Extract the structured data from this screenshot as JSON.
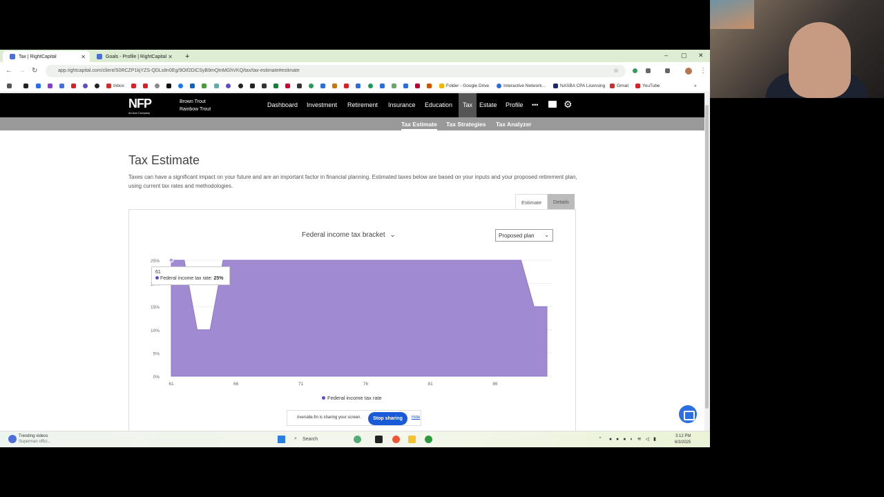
{
  "browser": {
    "tabs": [
      {
        "label": "Tax | RightCapital",
        "active": true
      },
      {
        "label": "Goals - Profile | RightCapital",
        "active": false
      }
    ],
    "url": "app.rightcapital.com/client/S0RCZP1kjYZS-QDLs8n0Eg/9OIf2DiCSyB9mQtnMGhVKQ/tax/tax-estimate#estimate",
    "bookmarks": [
      "Inbox",
      "Folder - Google Drive",
      "Interactive Network...",
      "NASBA CPA Licensing",
      "Gmail",
      "YouTube"
    ]
  },
  "app": {
    "logo": "NFP",
    "logo_sub": "An Aon Company",
    "client_1": "Brown Trout",
    "client_2": "Rainbow Trout",
    "nav": [
      "Dashboard",
      "Investment",
      "Retirement",
      "Insurance",
      "Education",
      "Tax",
      "Estate",
      "Profile"
    ],
    "more": "•••",
    "subnav": [
      "Tax Estimate",
      "Tax Strategies",
      "Tax Analyzer"
    ]
  },
  "content": {
    "title": "Tax Estimate",
    "description": "Taxes can have a significant impact on your future and are an important factor in financial planning. Estimated taxes below are based on your inputs and your proposed retirement plan, using current tax rates and methodologies.",
    "tab_estimate": "Estimate",
    "tab_details": "Details",
    "chart_select": "Federal income tax bracket",
    "plan_select": "Proposed plan",
    "tooltip_title": "61",
    "tooltip_label": "Federal income tax rate:",
    "tooltip_value": "25%"
  },
  "chart_data": {
    "type": "area",
    "x": [
      61,
      62,
      63,
      64,
      65,
      66,
      67,
      68,
      69,
      70,
      71,
      72,
      73,
      74,
      75,
      76,
      77,
      78,
      79,
      80,
      81,
      82,
      83,
      84,
      85,
      86,
      87,
      88,
      89,
      90
    ],
    "series": [
      {
        "name": "Federal income tax rate",
        "color": "#a08ad1",
        "values": [
          25,
          25,
          10,
          10,
          25,
          25,
          25,
          25,
          25,
          25,
          25,
          25,
          25,
          25,
          25,
          25,
          25,
          25,
          25,
          25,
          25,
          25,
          25,
          25,
          25,
          25,
          25,
          25,
          15,
          15
        ]
      }
    ],
    "y_ticks": [
      "0%",
      "5%",
      "10%",
      "15%",
      "20%",
      "25%"
    ],
    "x_ticks": [
      "61",
      "66",
      "71",
      "76",
      "81",
      "86"
    ],
    "ylim": [
      0,
      25
    ],
    "legend": "bottom"
  },
  "share": {
    "text": "riverside.fm is sharing your screen.",
    "stop": "Stop sharing",
    "hide": "Hide"
  },
  "taskbar": {
    "news_title": "Trending videos",
    "news_sub": "Superman offici...",
    "search": "Search",
    "time": "3:12 PM",
    "date": "6/3/2025"
  }
}
